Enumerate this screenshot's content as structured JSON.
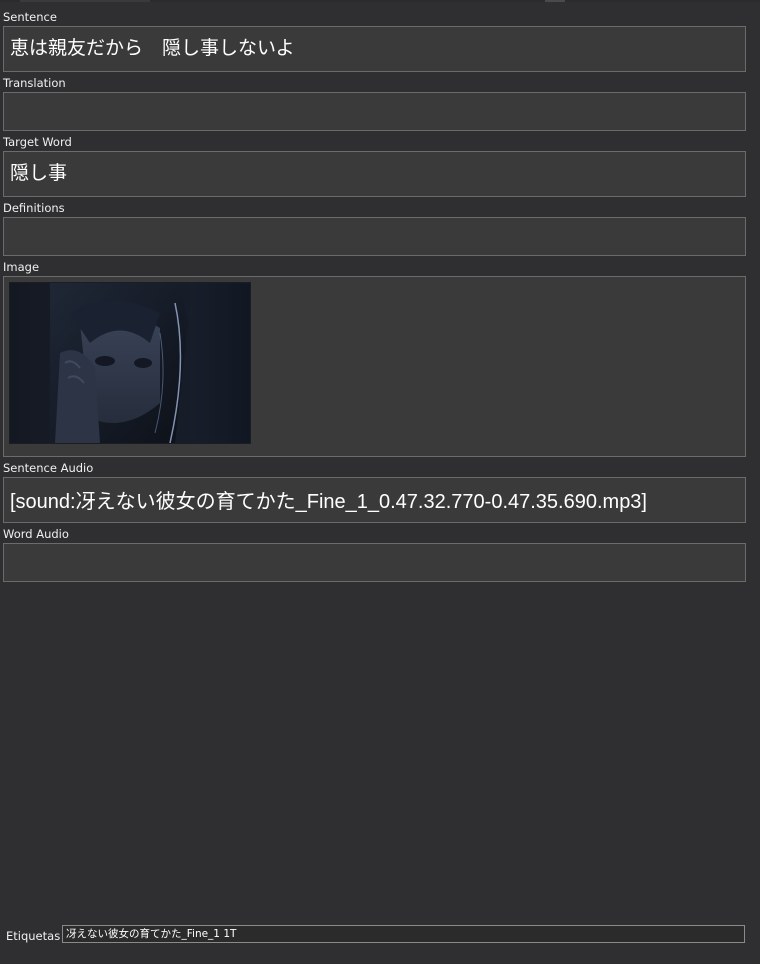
{
  "theme": {
    "background": "#2f2f31",
    "field_background": "#3a3a3a",
    "field_border": "#6b6b6b",
    "text": "#ffffff"
  },
  "fields": {
    "sentence": {
      "label": "Sentence",
      "value": "恵は親友だから　隠し事しないよ"
    },
    "translation": {
      "label": "Translation",
      "value": ""
    },
    "target_word": {
      "label": "Target Word",
      "value": "隠し事"
    },
    "definitions": {
      "label": "Definitions",
      "value": ""
    },
    "image": {
      "label": "Image",
      "image_icon": "anime-screenshot-girl-dark"
    },
    "sentence_audio": {
      "label": "Sentence Audio",
      "value": "[sound:冴えない彼女の育てかた_Fine_1_0.47.32.770-0.47.35.690.mp3]"
    },
    "word_audio": {
      "label": "Word Audio",
      "value": ""
    }
  },
  "tags": {
    "label": "Etiquetas",
    "value": "冴えない彼女の育てかた_Fine_1 1T"
  }
}
